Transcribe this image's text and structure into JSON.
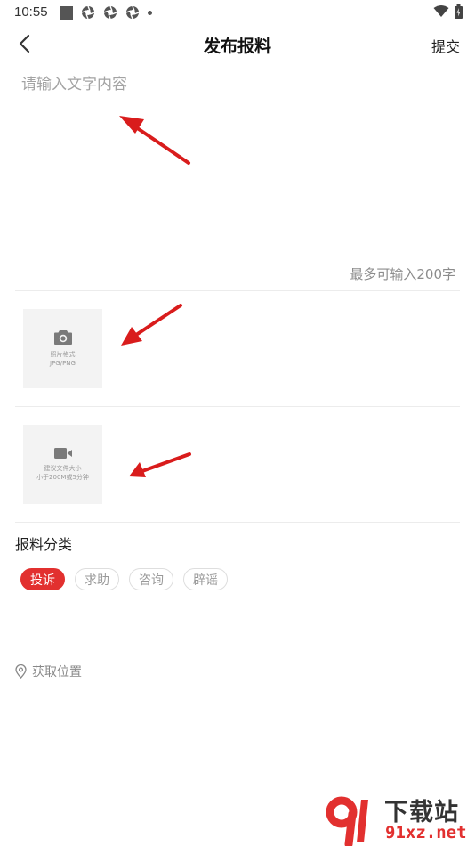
{
  "status_bar": {
    "time": "10:55"
  },
  "header": {
    "title": "发布报料",
    "submit_label": "提交"
  },
  "editor": {
    "placeholder": "请输入文字内容",
    "char_limit": "最多可输入200字"
  },
  "photo_upload": {
    "line1": "照片格式",
    "line2": "JPG/PNG",
    "icon": "camera-icon"
  },
  "video_upload": {
    "line1": "建议文件大小",
    "line2": "小于200M或5分钟",
    "icon": "video-camera-icon"
  },
  "category": {
    "title": "报料分类",
    "tags": [
      {
        "label": "投诉",
        "selected": true
      },
      {
        "label": "求助",
        "selected": false
      },
      {
        "label": "咨询",
        "selected": false
      },
      {
        "label": "辟谣",
        "selected": false
      }
    ]
  },
  "location": {
    "label": "获取位置",
    "icon": "location-pin-icon"
  },
  "watermark": {
    "logo_text": "91",
    "title": "下载站",
    "url": "91xz.net"
  },
  "colors": {
    "accent": "#e2302f",
    "placeholder": "#a3a3a3",
    "upload_bg": "#f3f3f3",
    "annotation_arrow": "#d91c1c"
  }
}
